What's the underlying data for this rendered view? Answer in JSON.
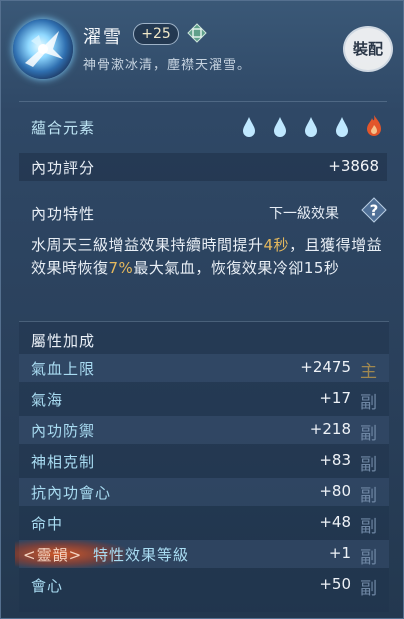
{
  "item": {
    "name": "濯雪",
    "level": "+25",
    "description": "神骨漱冰清，塵襟天濯雪。",
    "equip_label": "裝配"
  },
  "elements": {
    "label": "蘊合元素",
    "icons": [
      "water-drop-icon",
      "water-drop-icon",
      "water-drop-icon",
      "water-drop-icon",
      "fire-icon"
    ],
    "colors": {
      "water": "#bfe8ff",
      "fire": "#e2562b"
    }
  },
  "power": {
    "label": "內功評分",
    "value": "+3868"
  },
  "trait": {
    "label": "內功特性",
    "next_effect_label": "下一級效果",
    "desc_part1": "水周天三級增益效果持續時間提升",
    "desc_hl1": "4秒",
    "desc_part2": "，且獲得增益效果時恢復",
    "desc_hl2": "7%",
    "desc_part3": "最大氣血，恢復效果冷卻15秒"
  },
  "attributes": {
    "title": "屬性加成",
    "rows": [
      {
        "name": "氣血上限",
        "value": "+2475",
        "tag": "主"
      },
      {
        "name": "氣海",
        "value": "+17",
        "tag": "副"
      },
      {
        "name": "內功防禦",
        "value": "+218",
        "tag": "副"
      },
      {
        "name": "神相克制",
        "value": "+83",
        "tag": "副"
      },
      {
        "name": "抗內功會心",
        "value": "+80",
        "tag": "副"
      },
      {
        "name": "命中",
        "value": "+48",
        "tag": "副"
      },
      {
        "special_tag": "<靈韻>",
        "name": "特性效果等級",
        "value": "+1",
        "tag": "副"
      },
      {
        "name": "會心",
        "value": "+50",
        "tag": "副"
      }
    ]
  }
}
